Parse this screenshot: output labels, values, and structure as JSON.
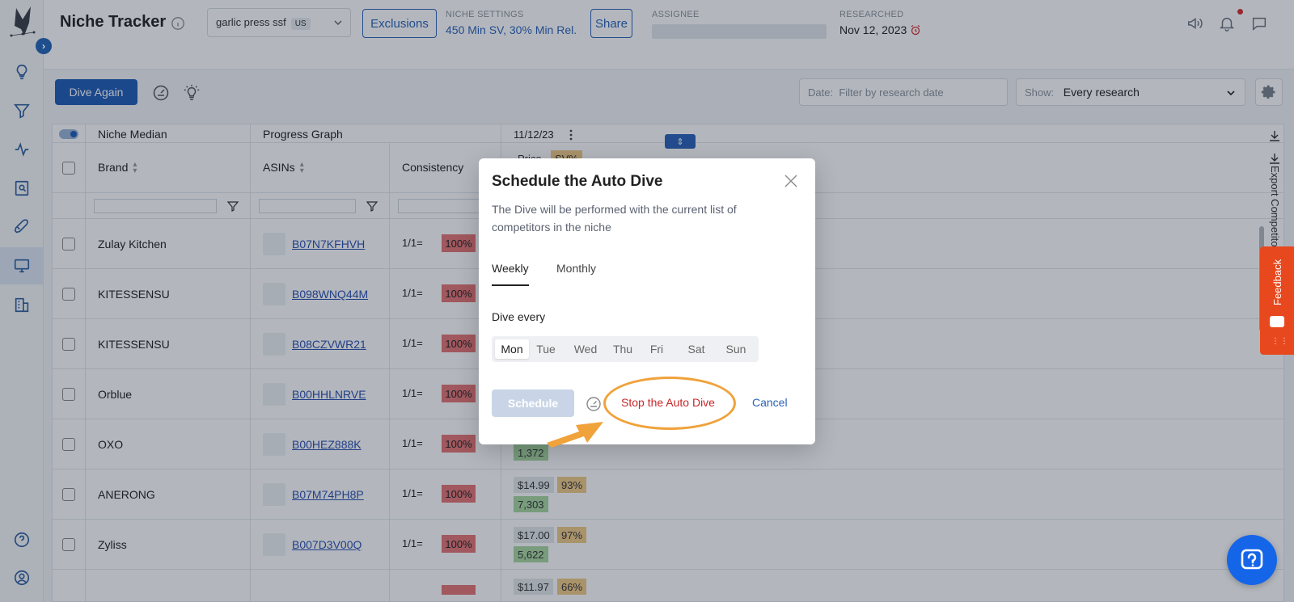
{
  "header": {
    "title": "Niche Tracker",
    "niche": "garlic press ssf",
    "country": "US",
    "exclusions_label": "Exclusions",
    "niche_settings_label": "NICHE SETTINGS",
    "niche_settings_value": "450 Min SV, 30% Min Rel.",
    "share_label": "Share",
    "assignee_label": "ASSIGNEE",
    "researched_label": "RESEARCHED",
    "researched_value": "Nov 12, 2023"
  },
  "toolbar": {
    "dive_again_label": "Dive Again",
    "date_prefix": "Date:",
    "date_placeholder": "Filter by research date",
    "show_label": "Show:",
    "show_value": "Every research"
  },
  "table": {
    "group_niche_median": "Niche Median",
    "group_progress_graph": "Progress Graph",
    "research_date": "11/12/23",
    "columns": {
      "brand": "Brand",
      "asins": "ASINs",
      "consistency": "Consistency"
    },
    "export_label": "Export Competitors",
    "rows": [
      {
        "brand": "Zulay Kitchen",
        "asin": "B07N7KFHVH",
        "cons": "1/1=",
        "pct": "100%"
      },
      {
        "brand": "KITESSENSU",
        "asin": "B098WNQ44M",
        "cons": "1/1=",
        "pct": "100%"
      },
      {
        "brand": "KITESSENSU",
        "asin": "B08CZVWR21",
        "cons": "1/1=",
        "pct": "100%"
      },
      {
        "brand": "Orblue",
        "asin": "B00HHLNRVE",
        "cons": "1/1=",
        "pct": "100%"
      },
      {
        "brand": "OXO",
        "asin": "B00HEZ888K",
        "cons": "1/1=",
        "pct": "100%",
        "sv": "1,372"
      },
      {
        "brand": "ANERONG",
        "asin": "B07M74PH8P",
        "cons": "1/1=",
        "pct": "100%",
        "price": "$14.99",
        "svp": "93%",
        "sv": "7,303"
      },
      {
        "brand": "Zyliss",
        "asin": "B007D3V00Q",
        "cons": "1/1=",
        "pct": "100%",
        "price": "$17.00",
        "svp": "97%",
        "sv": "5,622"
      },
      {
        "price": "$11.97",
        "svp": "66%"
      }
    ],
    "partial_headers": {
      "price": "Price",
      "svp": "SV%"
    }
  },
  "modal": {
    "title": "Schedule the Auto Dive",
    "description": "The Dive will be performed with the current list of competitors in the niche",
    "tab_weekly": "Weekly",
    "tab_monthly": "Monthly",
    "dive_every": "Dive every",
    "days": [
      "Mon",
      "Tue",
      "Wed",
      "Thu",
      "Fri",
      "Sat",
      "Sun"
    ],
    "selected_day": "Mon",
    "schedule_label": "Schedule",
    "stop_label": "Stop the Auto Dive",
    "cancel_label": "Cancel"
  },
  "feedback_label": "Feedback",
  "colors": {
    "primary": "#1f5bb5",
    "danger": "#c62828",
    "highlight": "#f0a23b",
    "feedback": "#e8481e"
  }
}
